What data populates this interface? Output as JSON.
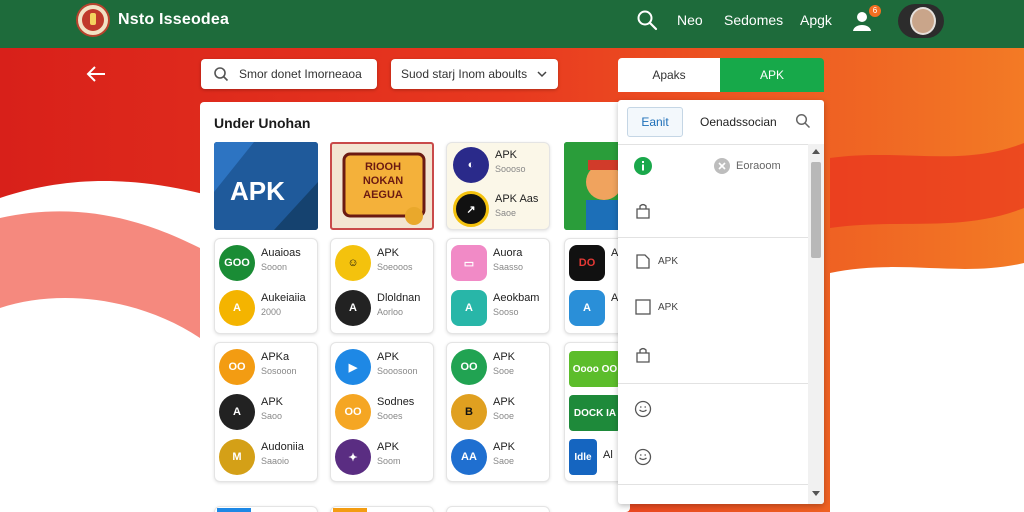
{
  "header": {
    "site_title": "Nsto Isseodea",
    "nav": [
      "Neo",
      "Sedomes",
      "Apgk"
    ],
    "notification_count": "6"
  },
  "toolbar": {
    "search_placeholder": "Smor donet Imorneaoa",
    "filter_value": "Suod starj Inom aboults"
  },
  "main": {
    "section_title": "Under Unohan",
    "banners": [
      {
        "label": "APK",
        "color": "#1f5a9b"
      },
      {
        "label": "RIOOH NOKAN AEGUA",
        "color": "#8e1b1b"
      },
      {
        "label": "",
        "color": "#2a9d3a"
      }
    ],
    "featured_apps": [
      {
        "name": "APK",
        "sub": "Soooso"
      },
      {
        "name": "APK Aas",
        "sub": "Saoe"
      }
    ],
    "tiles": [
      [
        {
          "name": "Auaioas",
          "sub": "Sooon",
          "icon": "GOO",
          "color": "#1a8c35"
        },
        {
          "name": "Aukeiaiia",
          "sub": "2000",
          "icon": "A",
          "color": "#f4b400"
        }
      ],
      [
        {
          "name": "APK",
          "sub": "Soeooos",
          "icon": "☺",
          "color": "#f4c20d"
        },
        {
          "name": "Dloldnan",
          "sub": "Aorloo",
          "icon": "A",
          "color": "#222222"
        }
      ],
      [
        {
          "name": "Auora",
          "sub": "Saasso",
          "icon": "▭",
          "color": "#f18ac6"
        },
        {
          "name": "Aeokbam",
          "sub": "Sooso",
          "icon": "A",
          "color": "#28b6a8"
        }
      ],
      [
        {
          "name": "Al",
          "sub": "",
          "icon": "DO",
          "color": "#111111"
        },
        {
          "name": "Al",
          "sub": "",
          "icon": "A",
          "color": "#2a8fd8"
        }
      ],
      [
        {
          "name": "APKa",
          "sub": "Sosooon",
          "icon": "OO",
          "color": "#f39c12"
        },
        {
          "name": "APK",
          "sub": "Saoo",
          "icon": "A",
          "color": "#222222"
        },
        {
          "name": "Audoniia",
          "sub": "Saaoio",
          "icon": "M",
          "color": "#d4a017"
        }
      ],
      [
        {
          "name": "APK",
          "sub": "Sooosoon",
          "icon": "▶",
          "color": "#1e88e5"
        },
        {
          "name": "Sodnes",
          "sub": "Sooes",
          "icon": "OO",
          "color": "#f5a623"
        },
        {
          "name": "APK",
          "sub": "Soom",
          "icon": "✦",
          "color": "#5a2d82"
        }
      ],
      [
        {
          "name": "APK",
          "sub": "Sooe",
          "icon": "OO",
          "color": "#21a352"
        },
        {
          "name": "APK",
          "sub": "Sooe",
          "icon": "B",
          "color": "#e0a020"
        },
        {
          "name": "APK",
          "sub": "Saoe",
          "icon": "AA",
          "color": "#1f6fd0"
        }
      ],
      [
        {
          "name": "",
          "sub": "",
          "icon": "Oooo OO",
          "color": "#5cbd2b"
        },
        {
          "name": "",
          "sub": "",
          "icon": "DOCK IA",
          "color": "#1e8a3a"
        },
        {
          "name": "Al",
          "sub": "",
          "icon": "Idle",
          "color": "#1565c0"
        }
      ]
    ]
  },
  "right_panel": {
    "tab_inactive": "Apaks",
    "tab_active": "APK",
    "sub_tab_active": "Eanit",
    "sub_tab_label": "Oenadssocian",
    "row1_label": "Eoraoom",
    "rows": [
      "",
      "",
      "APK",
      "APK",
      "",
      "",
      ""
    ]
  },
  "colors": {
    "header_green": "#1e6b3b",
    "accent_green": "#17a94a",
    "hero_red": "#e2231a",
    "hero_orange": "#f36f21"
  }
}
